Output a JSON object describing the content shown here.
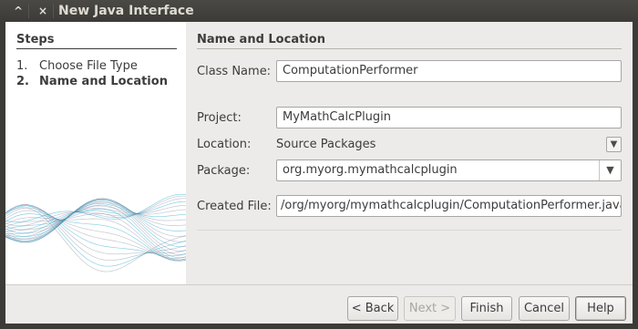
{
  "window": {
    "title": "New Java Interface",
    "minimize_glyph": "^",
    "close_glyph": "×"
  },
  "steps": {
    "heading": "Steps",
    "items": [
      {
        "num": "1.",
        "label": "Choose File Type"
      },
      {
        "num": "2.",
        "label": "Name and Location"
      }
    ]
  },
  "main": {
    "heading": "Name and Location",
    "class_name": {
      "label": "Class Name:",
      "value": "ComputationPerformer"
    },
    "project": {
      "label": "Project:",
      "value": "MyMathCalcPlugin"
    },
    "location": {
      "label": "Location:",
      "value": "Source Packages"
    },
    "package": {
      "label": "Package:",
      "value": "org.myorg.mymathcalcplugin"
    },
    "created_file": {
      "label": "Created File:",
      "value": "/org/myorg/mymathcalcplugin/ComputationPerformer.java"
    }
  },
  "buttons": {
    "back": "< Back",
    "next": "Next >",
    "finish": "Finish",
    "cancel": "Cancel",
    "help": "Help"
  },
  "icons": {
    "dropdown": "▼"
  },
  "colors": {
    "titlebar": "#3c3b37",
    "dialog_bg": "#edebe9",
    "wave": "#38b4d8"
  }
}
